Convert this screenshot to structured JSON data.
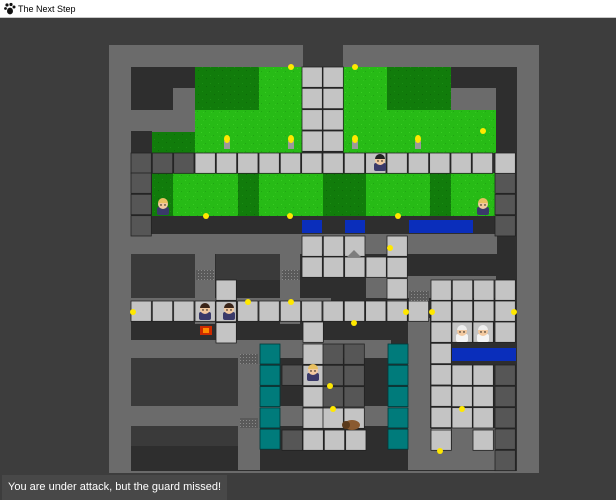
{
  "window": {
    "title": "The Next Step",
    "icon": "paw-print-icon"
  },
  "status": {
    "message": "You are under attack, but the guard missed!"
  },
  "colors": {
    "background": "#3d3d3d",
    "wall": "#6b6b6b",
    "floor_dark": "#2e2e2e",
    "grass": "#27bb16",
    "grass_dark": "#117c0b",
    "tile": "#c4c4c4",
    "tile_dark": "#565656",
    "water": "#0a2ebb",
    "teal": "#007b7b",
    "light": "#ffe800"
  },
  "entities": [
    {
      "kind": "guard",
      "name": "guard-blond-upper"
    },
    {
      "kind": "guard",
      "name": "guard-blond-left"
    },
    {
      "kind": "guard",
      "name": "guard-blond-right"
    },
    {
      "kind": "guard",
      "name": "guard-dark-left"
    },
    {
      "kind": "guard",
      "name": "guard-dark-right"
    },
    {
      "kind": "guard",
      "name": "guard-blond-lower"
    },
    {
      "kind": "scientist",
      "name": "scientist-left"
    },
    {
      "kind": "scientist",
      "name": "scientist-right"
    },
    {
      "kind": "player",
      "name": "player-crawling"
    }
  ]
}
